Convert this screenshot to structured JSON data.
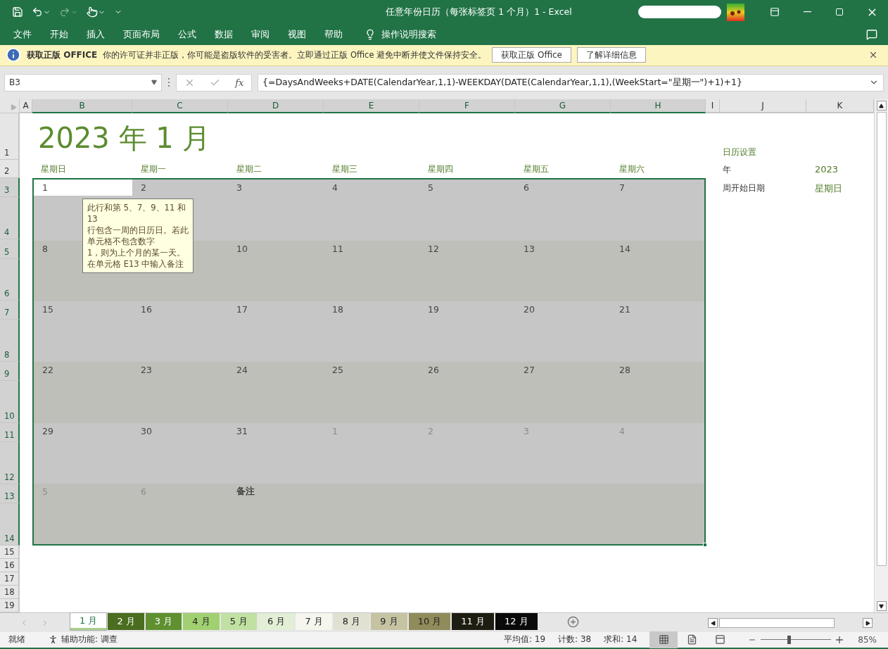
{
  "title_bar": {
    "title": "任意年份日历（每张标签页 1 个月）1  -  Excel"
  },
  "ribbon_tabs": [
    "文件",
    "开始",
    "插入",
    "页面布局",
    "公式",
    "数据",
    "审阅",
    "视图",
    "帮助"
  ],
  "tell_me": "操作说明搜索",
  "info_bar": {
    "heading": "获取正版 OFFICE",
    "message": "你的许可证并非正版，你可能是盗版软件的受害者。立即通过正版 Office 避免中断并使文件保持安全。",
    "buttons": [
      "获取正版 Office",
      "了解详细信息"
    ]
  },
  "formula_bar": {
    "name_box": "B3",
    "function_label": "fx",
    "formula": "{=DaysAndWeeks+DATE(CalendarYear,1,1)-WEEKDAY(DATE(CalendarYear,1,1),(WeekStart=\"星期一\")+1)+1}"
  },
  "columns": [
    {
      "label": "A",
      "selected": false
    },
    {
      "label": "B",
      "selected": true
    },
    {
      "label": "C",
      "selected": true
    },
    {
      "label": "D",
      "selected": true
    },
    {
      "label": "E",
      "selected": true
    },
    {
      "label": "F",
      "selected": true
    },
    {
      "label": "G",
      "selected": true
    },
    {
      "label": "H",
      "selected": true
    },
    {
      "label": "I",
      "selected": false
    },
    {
      "label": "J",
      "selected": false
    },
    {
      "label": "K",
      "selected": false
    }
  ],
  "rows": [
    {
      "label": "1",
      "selected": false
    },
    {
      "label": "2",
      "selected": false
    },
    {
      "label": "3",
      "selected": true
    },
    {
      "label": "4",
      "selected": true
    },
    {
      "label": "5",
      "selected": true
    },
    {
      "label": "6",
      "selected": true
    },
    {
      "label": "7",
      "selected": true
    },
    {
      "label": "8",
      "selected": true
    },
    {
      "label": "9",
      "selected": true
    },
    {
      "label": "10",
      "selected": true
    },
    {
      "label": "11",
      "selected": true
    },
    {
      "label": "12",
      "selected": true
    },
    {
      "label": "13",
      "selected": true
    },
    {
      "label": "14",
      "selected": true
    },
    {
      "label": "15",
      "selected": false
    },
    {
      "label": "16",
      "selected": false
    },
    {
      "label": "17",
      "selected": false
    },
    {
      "label": "18",
      "selected": false
    },
    {
      "label": "19",
      "selected": false
    }
  ],
  "calendar": {
    "title": "2023 年 1 月",
    "weekdays": [
      "星期日",
      "星期一",
      "星期二",
      "星期三",
      "星期四",
      "星期五",
      "星期六"
    ],
    "weeks": [
      [
        {
          "kind": "day",
          "text": "1",
          "in_month": true,
          "selected": true
        },
        {
          "kind": "day",
          "text": "2",
          "in_month": true,
          "selected": false
        },
        {
          "kind": "day",
          "text": "3",
          "in_month": true,
          "selected": false
        },
        {
          "kind": "day",
          "text": "4",
          "in_month": true,
          "selected": false
        },
        {
          "kind": "day",
          "text": "5",
          "in_month": true,
          "selected": false
        },
        {
          "kind": "day",
          "text": "6",
          "in_month": true,
          "selected": false
        },
        {
          "kind": "day",
          "text": "7",
          "in_month": true,
          "selected": false
        }
      ],
      [
        {
          "kind": "day",
          "text": "8",
          "in_month": true,
          "selected": false
        },
        {
          "kind": "blank"
        },
        {
          "kind": "day",
          "text": "10",
          "in_month": true,
          "selected": false
        },
        {
          "kind": "day",
          "text": "11",
          "in_month": true,
          "selected": false
        },
        {
          "kind": "day",
          "text": "12",
          "in_month": true,
          "selected": false
        },
        {
          "kind": "day",
          "text": "13",
          "in_month": true,
          "selected": false
        },
        {
          "kind": "day",
          "text": "14",
          "in_month": true,
          "selected": false
        }
      ],
      [
        {
          "kind": "day",
          "text": "15",
          "in_month": true,
          "selected": false
        },
        {
          "kind": "day",
          "text": "16",
          "in_month": true,
          "selected": false
        },
        {
          "kind": "day",
          "text": "17",
          "in_month": true,
          "selected": false
        },
        {
          "kind": "day",
          "text": "18",
          "in_month": true,
          "selected": false
        },
        {
          "kind": "day",
          "text": "19",
          "in_month": true,
          "selected": false
        },
        {
          "kind": "day",
          "text": "20",
          "in_month": true,
          "selected": false
        },
        {
          "kind": "day",
          "text": "21",
          "in_month": true,
          "selected": false
        }
      ],
      [
        {
          "kind": "day",
          "text": "22",
          "in_month": true,
          "selected": false
        },
        {
          "kind": "day",
          "text": "23",
          "in_month": true,
          "selected": false
        },
        {
          "kind": "day",
          "text": "24",
          "in_month": true,
          "selected": false
        },
        {
          "kind": "day",
          "text": "25",
          "in_month": true,
          "selected": false
        },
        {
          "kind": "day",
          "text": "26",
          "in_month": true,
          "selected": false
        },
        {
          "kind": "day",
          "text": "27",
          "in_month": true,
          "selected": false
        },
        {
          "kind": "day",
          "text": "28",
          "in_month": true,
          "selected": false
        }
      ],
      [
        {
          "kind": "day",
          "text": "29",
          "in_month": true,
          "selected": false
        },
        {
          "kind": "day",
          "text": "30",
          "in_month": true,
          "selected": false
        },
        {
          "kind": "day",
          "text": "31",
          "in_month": true,
          "selected": false
        },
        {
          "kind": "day",
          "text": "1",
          "in_month": false,
          "selected": false
        },
        {
          "kind": "day",
          "text": "2",
          "in_month": false,
          "selected": false
        },
        {
          "kind": "day",
          "text": "3",
          "in_month": false,
          "selected": false
        },
        {
          "kind": "day",
          "text": "4",
          "in_month": false,
          "selected": false
        }
      ],
      [
        {
          "kind": "day",
          "text": "5",
          "in_month": false,
          "selected": false
        },
        {
          "kind": "day",
          "text": "6",
          "in_month": false,
          "selected": false
        },
        {
          "kind": "note",
          "text": "备注"
        }
      ]
    ]
  },
  "comment": {
    "lines": [
      "此行和第 5、7、9、11 和",
      "13",
      "行包含一周的日历日。若此",
      "单元格不包含数字",
      "1，则为上个月的某一天。",
      "在单元格 E13 中输入备注"
    ]
  },
  "settings": {
    "heading": "日历设置",
    "fields": [
      {
        "label": "年",
        "value": "2023"
      },
      {
        "label": "周开始日期",
        "value": "星期日"
      }
    ]
  },
  "sheet_tabs": [
    {
      "label": "1 月",
      "selected": true,
      "color": "#a9d08e"
    },
    {
      "label": "2 月",
      "selected": false,
      "color": "#4a6d1f"
    },
    {
      "label": "3 月",
      "selected": false,
      "color": "#5f9131"
    },
    {
      "label": "4 月",
      "selected": false,
      "color": "#a1d070"
    },
    {
      "label": "5 月",
      "selected": false,
      "color": "#c0e1a2"
    },
    {
      "label": "6 月",
      "selected": false,
      "color": "#e2efd6"
    },
    {
      "label": "7 月",
      "selected": false,
      "color": "#f5f6ee"
    },
    {
      "label": "8 月",
      "selected": false,
      "color": "#e1e1d2"
    },
    {
      "label": "9 月",
      "selected": false,
      "color": "#c6c3a3"
    },
    {
      "label": "10 月",
      "selected": false,
      "color": "#8f8b5b"
    },
    {
      "label": "11 月",
      "selected": false,
      "color": "#1d1d12"
    },
    {
      "label": "12 月",
      "selected": false,
      "color": "#0a0a0a"
    }
  ],
  "status_bar": {
    "ready": "就绪",
    "accessibility": "辅助功能: 调查",
    "stats": [
      "平均值: 19",
      "计数: 38",
      "求和: 14"
    ],
    "views": [
      {
        "kind": "normal",
        "selected": true
      },
      {
        "kind": "page_layout",
        "selected": false
      },
      {
        "kind": "page_break",
        "selected": false
      }
    ],
    "zoom": {
      "level": 0.4,
      "text": "85%"
    }
  }
}
